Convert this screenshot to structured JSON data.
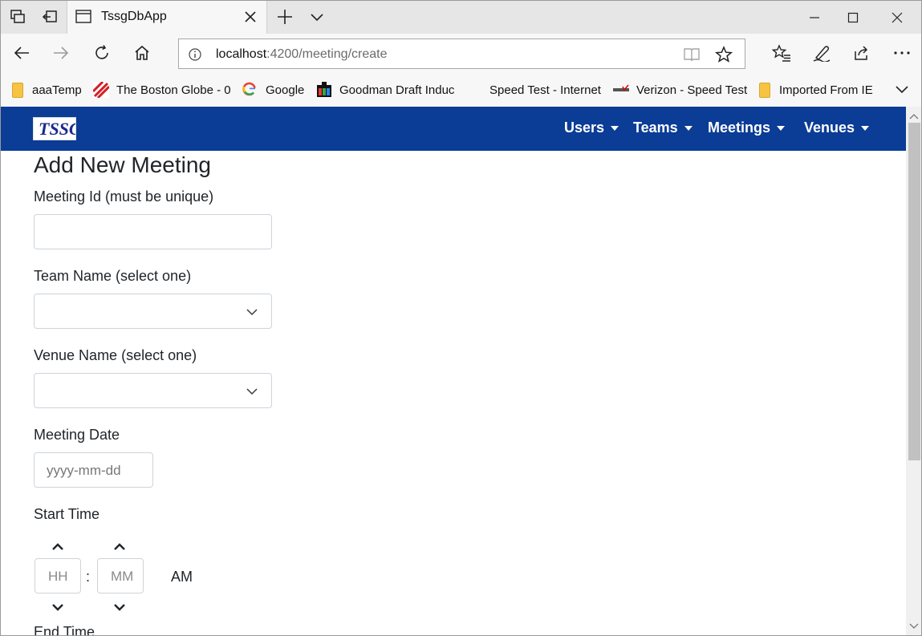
{
  "browser": {
    "tab": {
      "title": "TssgDbApp"
    },
    "address": {
      "host": "localhost",
      "path": ":4200/meeting/create"
    },
    "favorites": [
      {
        "label": "aaaTemp",
        "icon": "folder-icon"
      },
      {
        "label": "The Boston Globe - 0",
        "icon": "boston-globe-icon"
      },
      {
        "label": "Google",
        "icon": "google-icon"
      },
      {
        "label": "Goodman Draft Induc",
        "icon": "goodman-icon"
      },
      {
        "label": "Speed Test - Internet",
        "icon": ""
      },
      {
        "label": "Verizon - Speed Test",
        "icon": "verizon-icon"
      },
      {
        "label": "Imported From IE",
        "icon": "folder-icon"
      }
    ]
  },
  "app": {
    "brand": "TSSG",
    "nav": [
      "Users",
      "Teams",
      "Meetings",
      "Venues"
    ]
  },
  "form": {
    "title": "Add New Meeting",
    "meeting_id_label": "Meeting Id (must be unique)",
    "meeting_id_value": "",
    "team_label": "Team Name (select one)",
    "team_value": "",
    "venue_label": "Venue Name (select one)",
    "venue_value": "",
    "date_label": "Meeting Date",
    "date_placeholder": "yyyy-mm-dd",
    "start_label": "Start Time",
    "hour_placeholder": "HH",
    "minute_placeholder": "MM",
    "separator": ":",
    "meridian": "AM",
    "end_label": "End Time"
  },
  "colors": {
    "navbar": "#0b3c96",
    "text": "#212529"
  }
}
